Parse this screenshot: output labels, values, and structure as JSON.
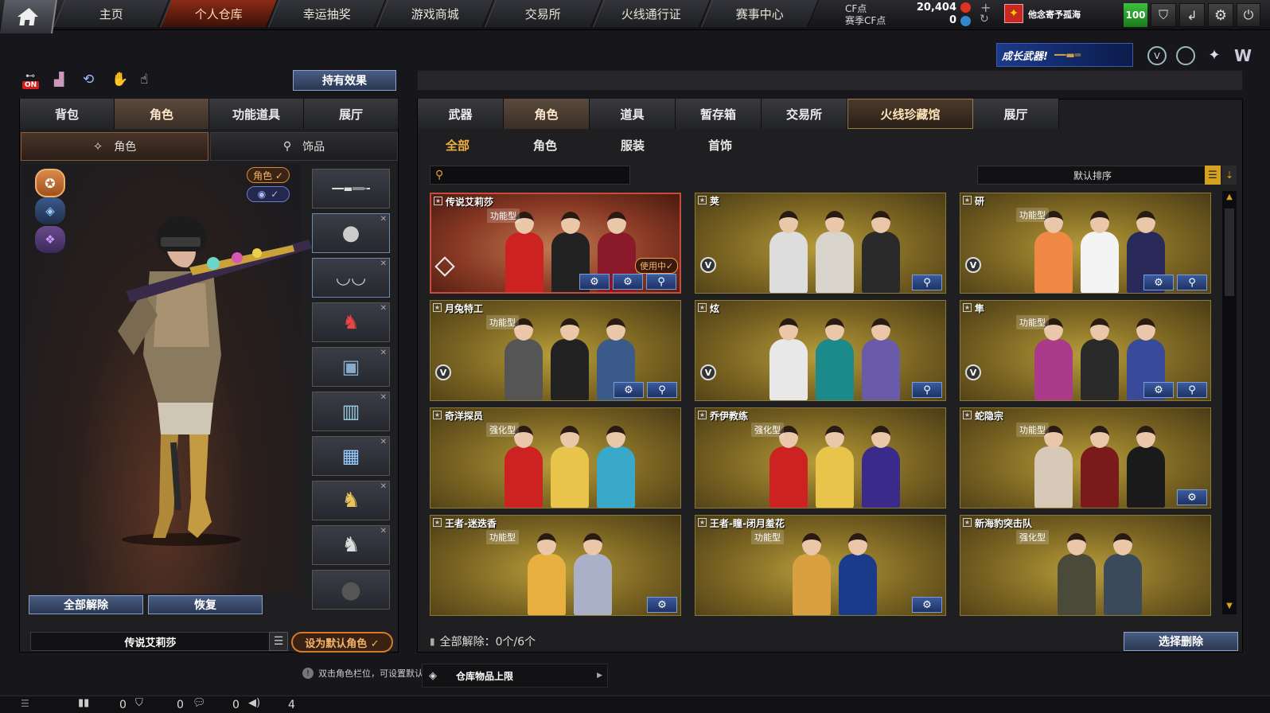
{
  "topnav": [
    "主页",
    "个人仓库",
    "幸运抽奖",
    "游戏商城",
    "交易所",
    "火线通行证",
    "赛事中心"
  ],
  "currency": {
    "cf_label": "CF点",
    "cf_value": "20,404",
    "season_label": "赛季CF点",
    "season_value": "0"
  },
  "player": {
    "name": "他念寄予孤海",
    "level": "100"
  },
  "banner": {
    "text": "成长武器!"
  },
  "left": {
    "hold_effect": "持有效果",
    "on_badge": "ON",
    "tabs": [
      "背包",
      "角色",
      "功能道具",
      "展厅"
    ],
    "subtabs": [
      "角色",
      "饰品"
    ],
    "char_toggle": "角色 ✓",
    "eye_toggle": "✓",
    "release_all": "全部解除",
    "restore": "恢复",
    "current_name": "传说艾莉莎",
    "set_default": "设为默认角色 ✓",
    "hint": "双击角色栏位，可设置默认角色。",
    "storage_limit": "仓库物品上限"
  },
  "right": {
    "tabs": [
      "武器",
      "角色",
      "道具",
      "暂存箱",
      "交易所",
      "火线珍藏馆",
      "展厅"
    ],
    "subtabs": [
      "全部",
      "角色",
      "服装",
      "首饰"
    ],
    "search_placeholder": "",
    "sort": "默认排序",
    "release_all_status": "全部解除：0个/6个",
    "select_delete": "选择删除"
  },
  "cards": [
    {
      "name": "传说艾莉莎",
      "tag": "功能型",
      "in_use": "使用中✓"
    },
    {
      "name": "荚",
      "tag": ""
    },
    {
      "name": "研",
      "tag": "功能型"
    },
    {
      "name": "月兔特工",
      "tag": "功能型"
    },
    {
      "name": "炫",
      "tag": ""
    },
    {
      "name": "隼",
      "tag": "功能型"
    },
    {
      "name": "奇洋探员",
      "tag": "强化型"
    },
    {
      "name": "乔伊教练",
      "tag": "强化型"
    },
    {
      "name": "蛇隐宗",
      "tag": "功能型"
    },
    {
      "name": "王者-迷迭香",
      "tag": "功能型"
    },
    {
      "name": "王者-瞳-闭月羞花",
      "tag": "功能型"
    },
    {
      "name": "新海豹突击队",
      "tag": "强化型"
    }
  ],
  "statusbar": {
    "a": "0",
    "b": "0",
    "c": "0",
    "d": "4"
  }
}
